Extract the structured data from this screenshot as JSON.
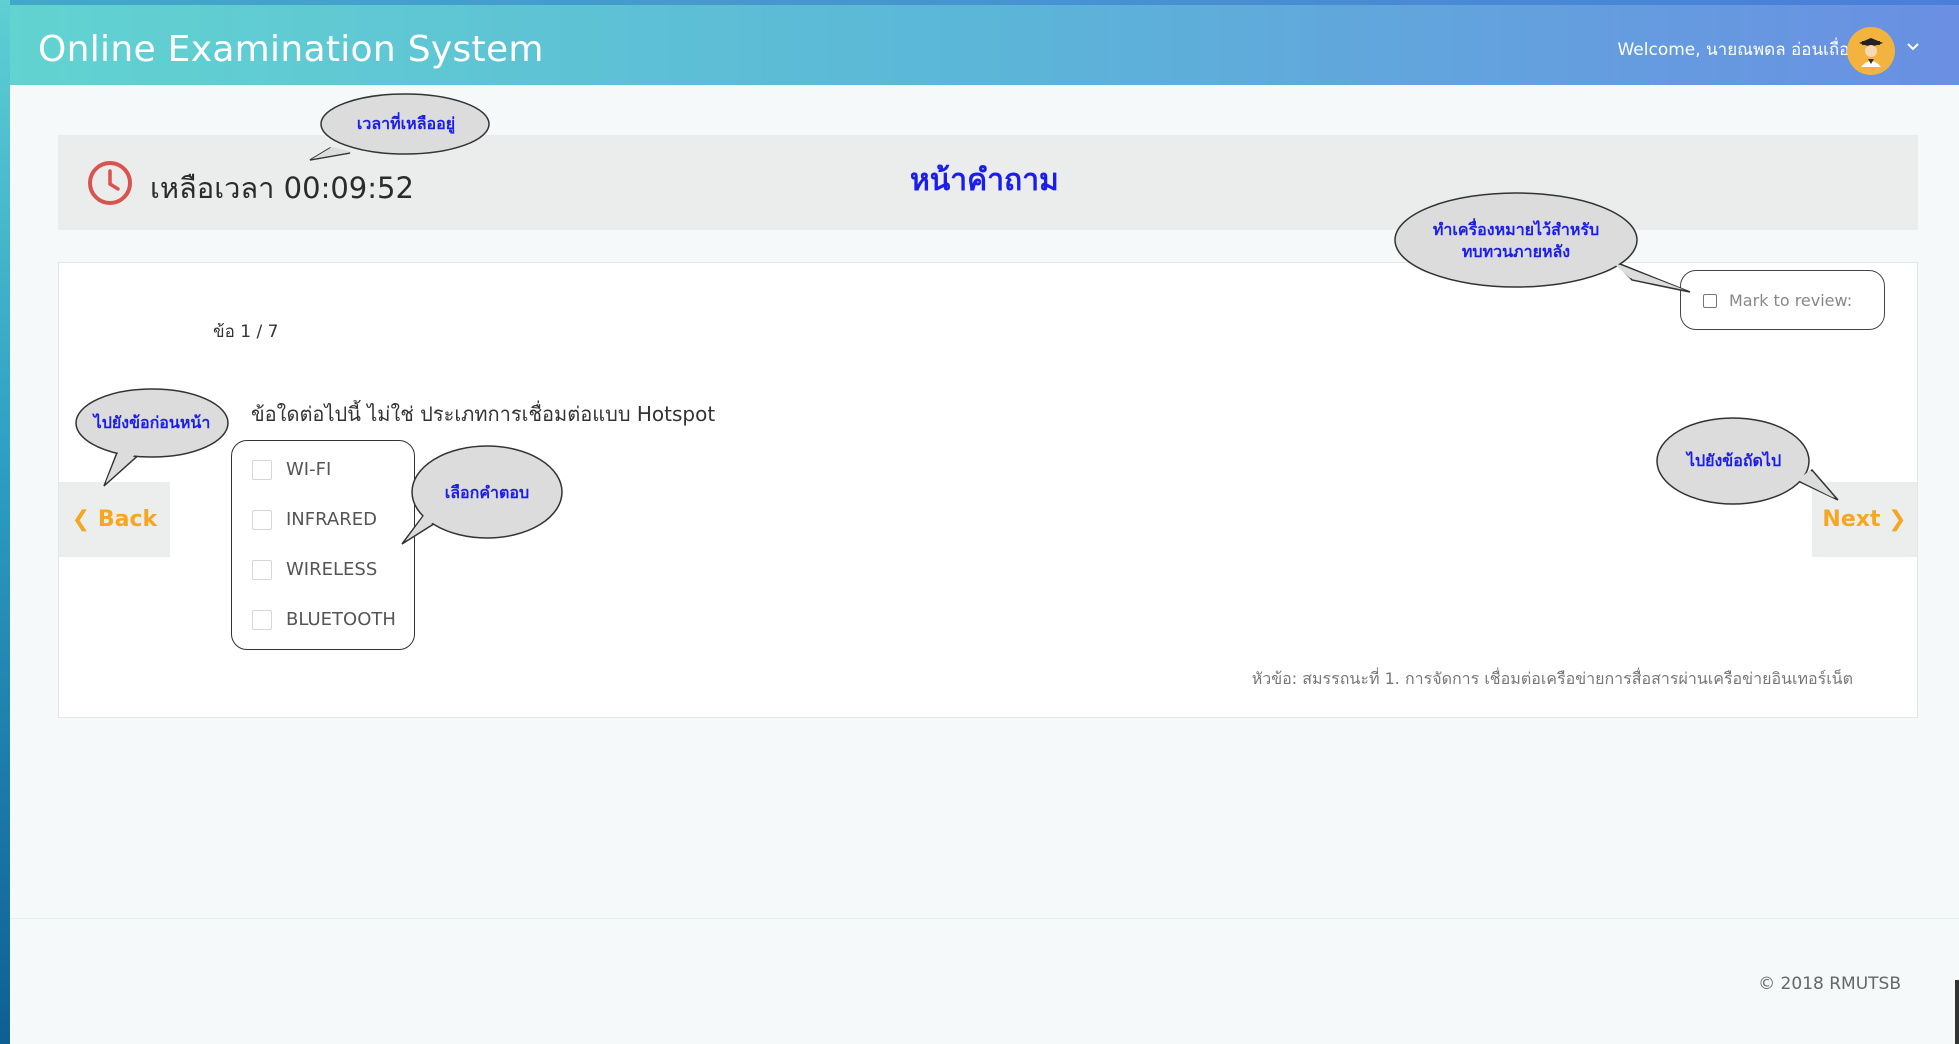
{
  "header": {
    "app_title": "Online Examination System",
    "welcome": "Welcome, นายณพดล อ่อนเถื่อน",
    "avatar_icon": "graduate-avatar-icon",
    "menu_icon": "chevron-down-icon"
  },
  "timer": {
    "label": "เหลือเวลา 00:09:52",
    "icon": "clock-icon"
  },
  "page_title": "หน้าคำถาม",
  "question": {
    "number": "ข้อ 1 / 7",
    "text": "ข้อใดต่อไปนี้ ไม่ใช่ ประเภทการเชื่อมต่อแบบ Hotspot",
    "options": [
      "WI-FI",
      "INFRARED",
      "WIRELESS",
      "BLUETOOTH"
    ],
    "mark_review_label": "Mark to review:"
  },
  "nav": {
    "back_label": "❮ Back",
    "next_label": "Next ❯"
  },
  "topic": "หัวข้อ: สมรรถนะที่ 1. การจัดการ เชื่อมต่อเครือข่ายการสื่อสารผ่านเครือข่ายอินเทอร์เน็ต",
  "footer": {
    "copyright": "© 2018 RMUTSB"
  },
  "callouts": {
    "time_remaining": "เวลาที่เหลืออยู่",
    "mark_line1": "ทำเครื่องหมายไว้สำหรับ",
    "mark_line2": "ทบทวนภายหลัง",
    "prev_question": "ไปยังข้อก่อนหน้า",
    "choose_answer": "เลือกคำตอบ",
    "next_question": "ไปยังข้อถัดไป"
  },
  "colors": {
    "accent_blue": "#1a1ee8",
    "nav_orange": "#f5a623",
    "clock_red": "#d9534f"
  }
}
